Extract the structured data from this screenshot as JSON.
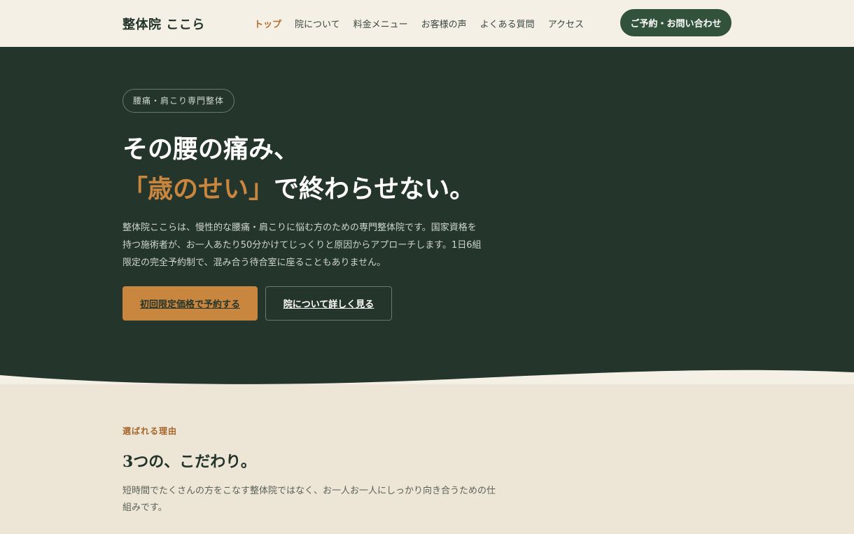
{
  "header": {
    "logo": "整体院 ここら",
    "nav": [
      {
        "label": "トップ",
        "active": true
      },
      {
        "label": "院について"
      },
      {
        "label": "料金メニュー"
      },
      {
        "label": "お客様の声"
      },
      {
        "label": "よくある質問"
      },
      {
        "label": "アクセス"
      }
    ],
    "cta": "ご予約・お問い合わせ"
  },
  "hero": {
    "badge": "腰痛・肩こり専門整体",
    "headline_line1": "その腰の痛み、",
    "headline_accent": "「歳のせい」",
    "headline_rest": "で終わらせない。",
    "lead": "整体院ここらは、慢性的な腰痛・肩こりに悩む方のための専門整体院です。国家資格を持つ施術者が、お一人あたり50分かけてじっくりと原因からアプローチします。1日6組限定の完全予約制で、混み合う待合室に座ることもありません。",
    "primary_button": "初回限定価格で予約する",
    "secondary_button": "院について詳しく見る"
  },
  "reasons": {
    "eyebrow": "選ばれる理由",
    "title": "3つの、こだわり。",
    "text": "短時間でたくさんの方をこなす整体院ではなく、お一人お一人にしっかり向き合うための仕組みです。"
  },
  "colors": {
    "hero_bg": "#24352b",
    "accent": "#c9863f",
    "cta_bg": "#33523b",
    "page_bg": "#ede6d6"
  }
}
